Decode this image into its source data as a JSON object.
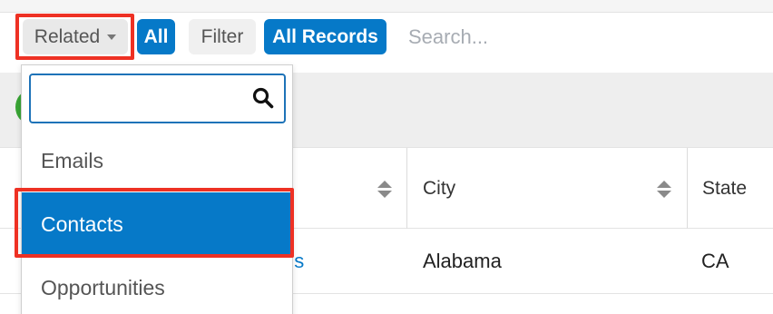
{
  "toolbar": {
    "related_label": "Related",
    "all_label": "All",
    "filter_label": "Filter",
    "all_records_label": "All Records",
    "search_placeholder": "Search..."
  },
  "table": {
    "columns": [
      "City",
      "State"
    ],
    "row": {
      "name_fragment": "ns",
      "city": "Alabama",
      "state": "CA"
    }
  },
  "dropdown": {
    "search_value": "",
    "items": [
      "Emails",
      "Contacts",
      "Opportunities"
    ],
    "selected": "Contacts"
  },
  "colors": {
    "accent": "#0679c8",
    "highlight": "#ee3124",
    "status_green": "#39a535"
  }
}
